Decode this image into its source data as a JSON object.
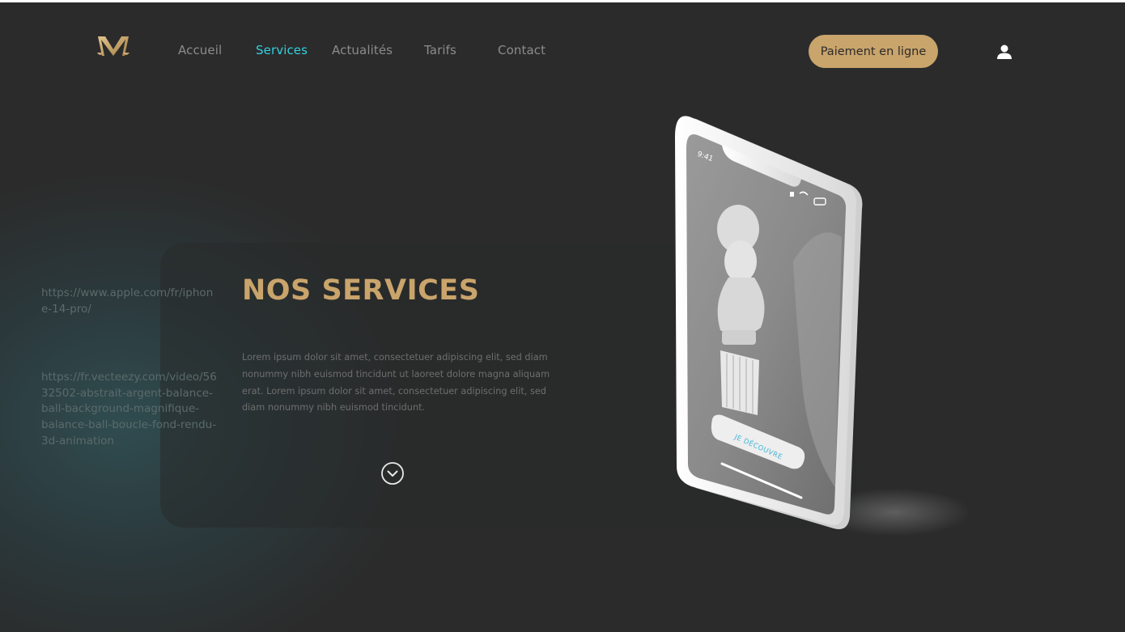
{
  "header": {
    "nav": [
      {
        "label": "Accueil",
        "active": false
      },
      {
        "label": "Services",
        "active": true
      },
      {
        "label": "Actualités",
        "active": false
      },
      {
        "label": "Tarifs",
        "active": false
      },
      {
        "label": "Contact",
        "active": false
      }
    ],
    "pay_button": "Paiement en ligne",
    "logo_icon": "scales-of-justice-logo",
    "user_icon": "user-icon"
  },
  "hero": {
    "title": "NOS SERVICES",
    "body": "Lorem ipsum dolor sit amet, consectetuer adipiscing elit, sed diam nonummy nibh euismod tincidunt ut laoreet dolore magna aliquam erat. Lorem ipsum dolor sit amet, consectetuer adipiscing elit, sed diam nonummy nibh euismod tincidunt.",
    "scroll_icon": "chevron-down-circle-icon"
  },
  "references": {
    "apple": "https://www.apple.com/fr/iphone-14-pro/",
    "vecteezy": "https://fr.vecteezy.com/video/5632502-abstrait-argent-balance-ball-background-magnifique-balance-ball-boucle-fond-rendu-3d-animation"
  },
  "phone": {
    "time": "9:41",
    "cta": "JE DÉCOUVRE"
  },
  "colors": {
    "background": "#2b2b2b",
    "accent_gold": "#c9a46b",
    "active_nav": "#33cfe0",
    "cta_blue": "#3fb4d6"
  }
}
